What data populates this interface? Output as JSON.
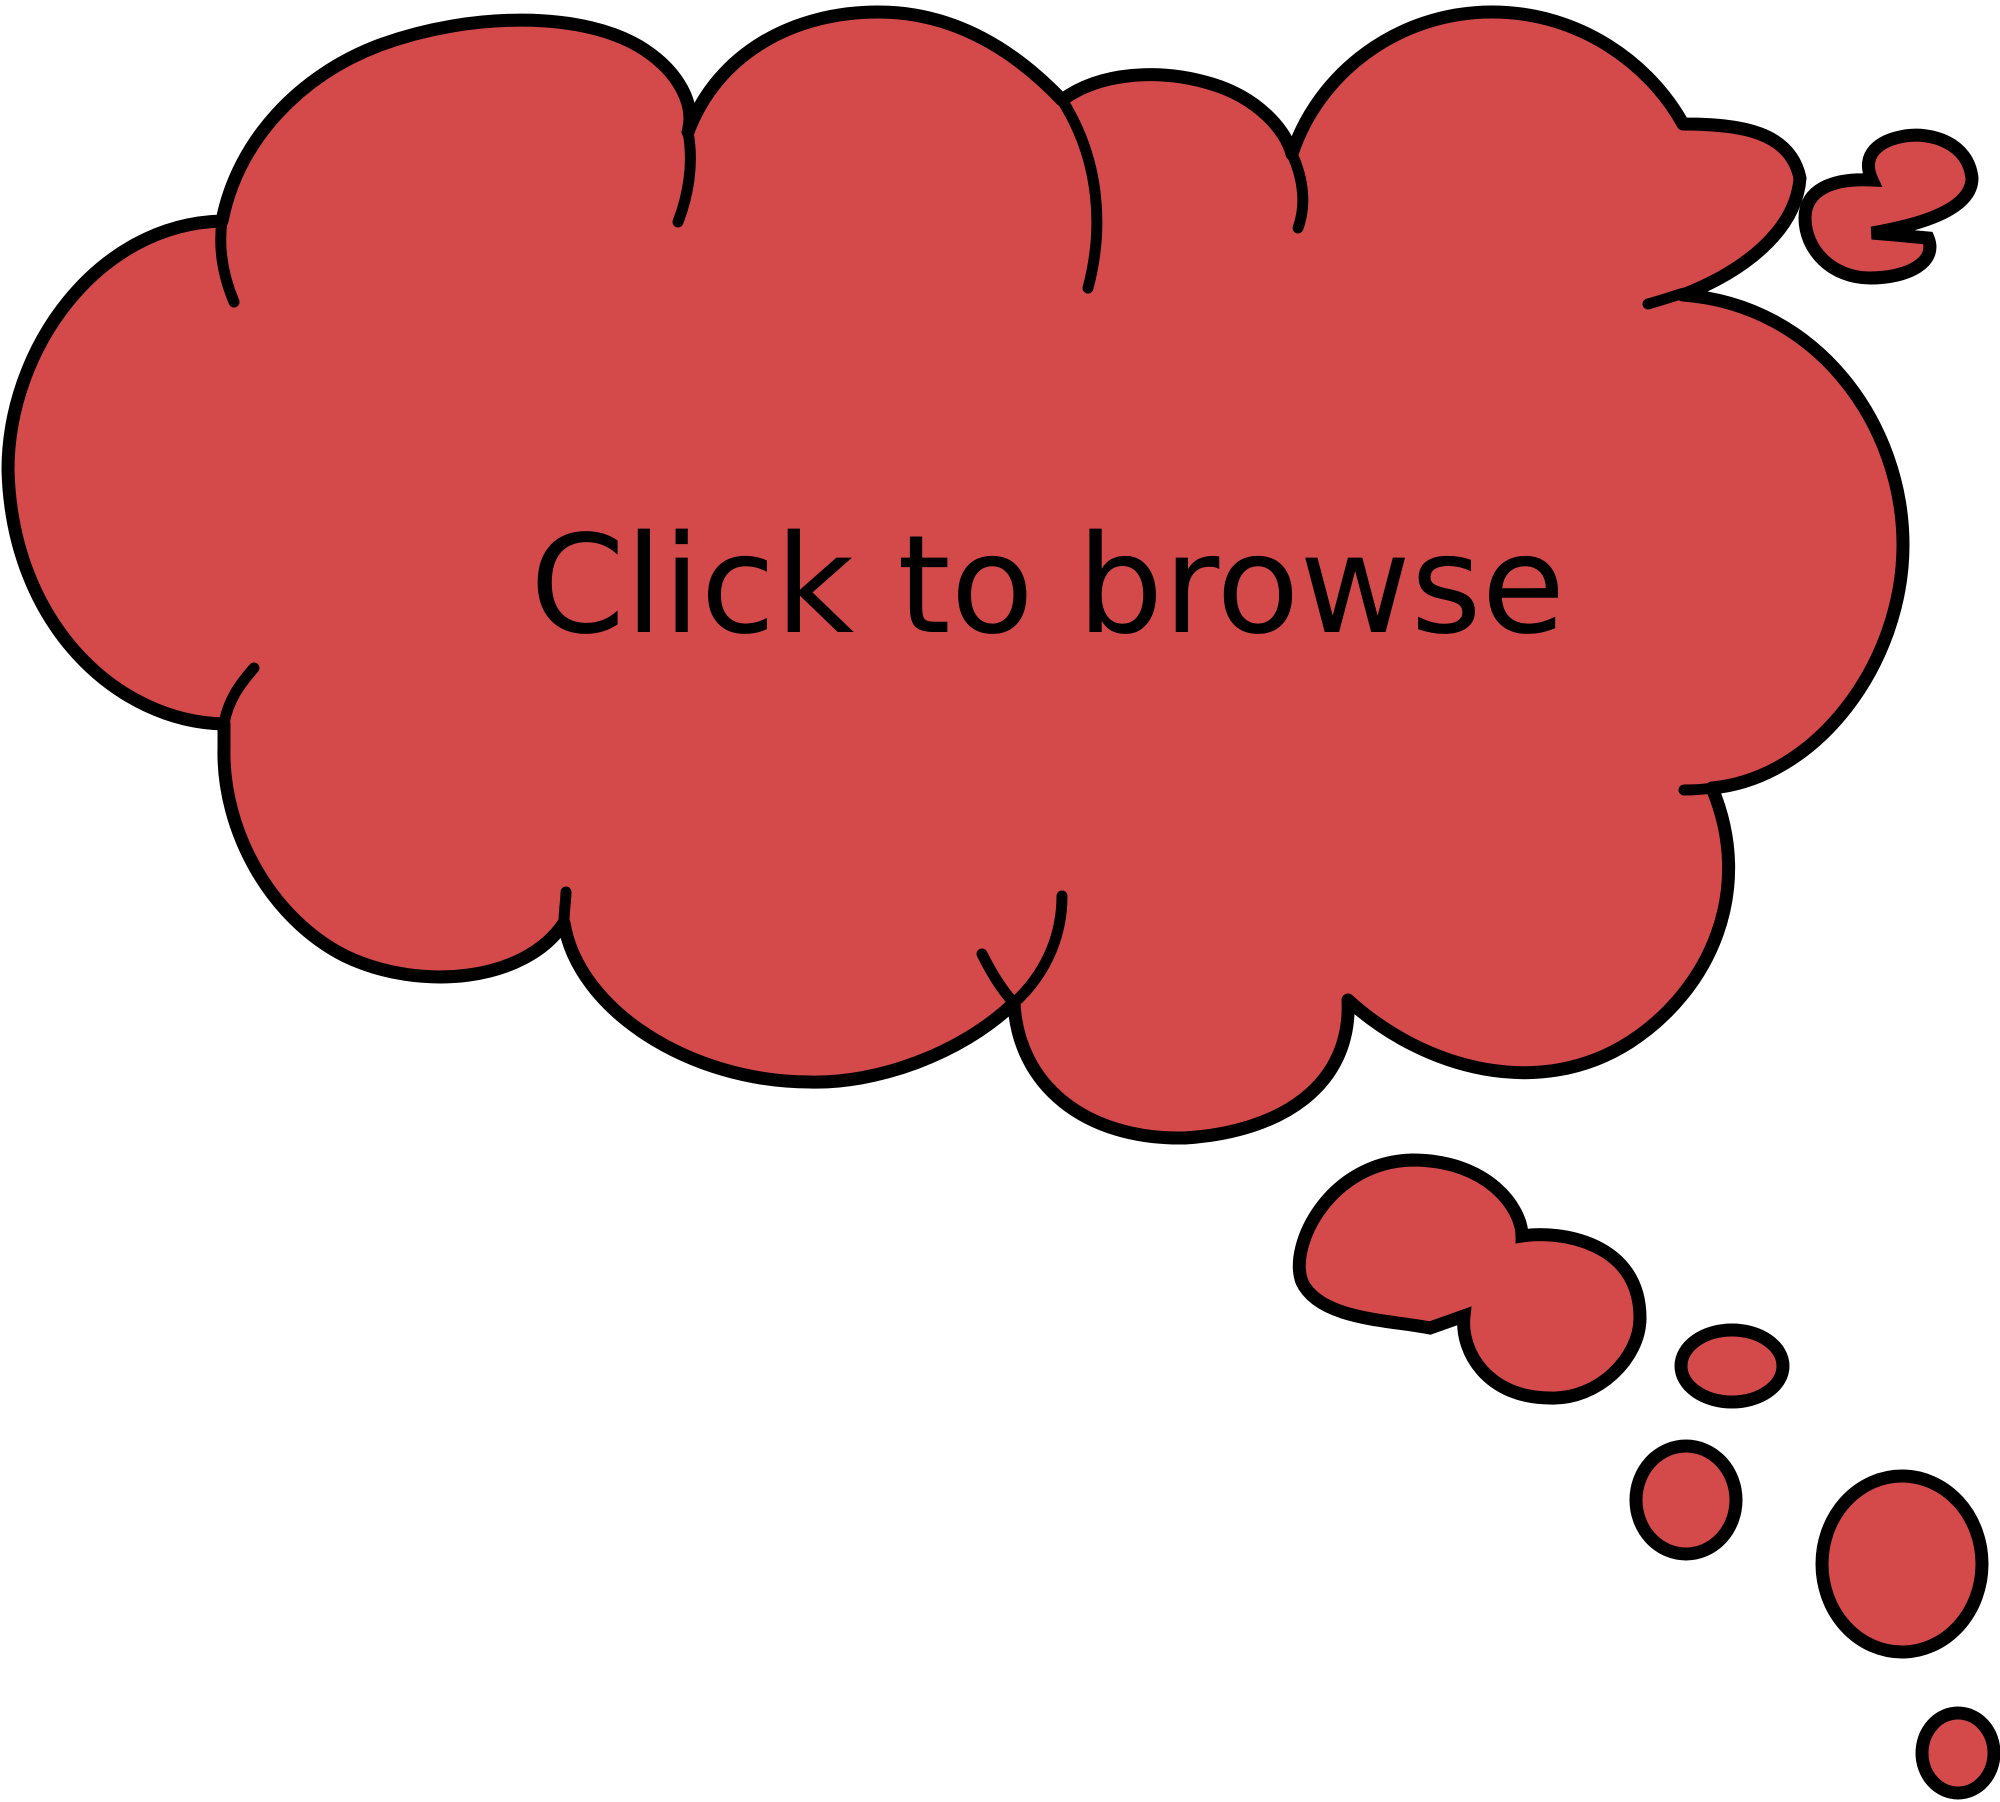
{
  "cloud": {
    "label": "Click to browse",
    "fill_color": "#d44a4a",
    "outline_color": "#000000"
  },
  "background_color": "#ffffff",
  "icon": "thought-bubble-icon"
}
